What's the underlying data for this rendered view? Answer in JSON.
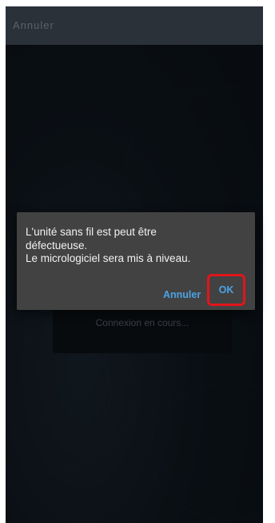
{
  "topbar": {
    "cancel_label": "Annuler"
  },
  "progress": {
    "status_text": "Connexion en cours..."
  },
  "dialog": {
    "message": "L'unité sans fil est peut être\ndéfectueuse.\nLe micrologiciel sera mis à niveau.",
    "cancel_label": "Annuler",
    "ok_label": "OK",
    "ok_highlight_color": "#e3141b",
    "accent_color": "#4aa3e6"
  }
}
